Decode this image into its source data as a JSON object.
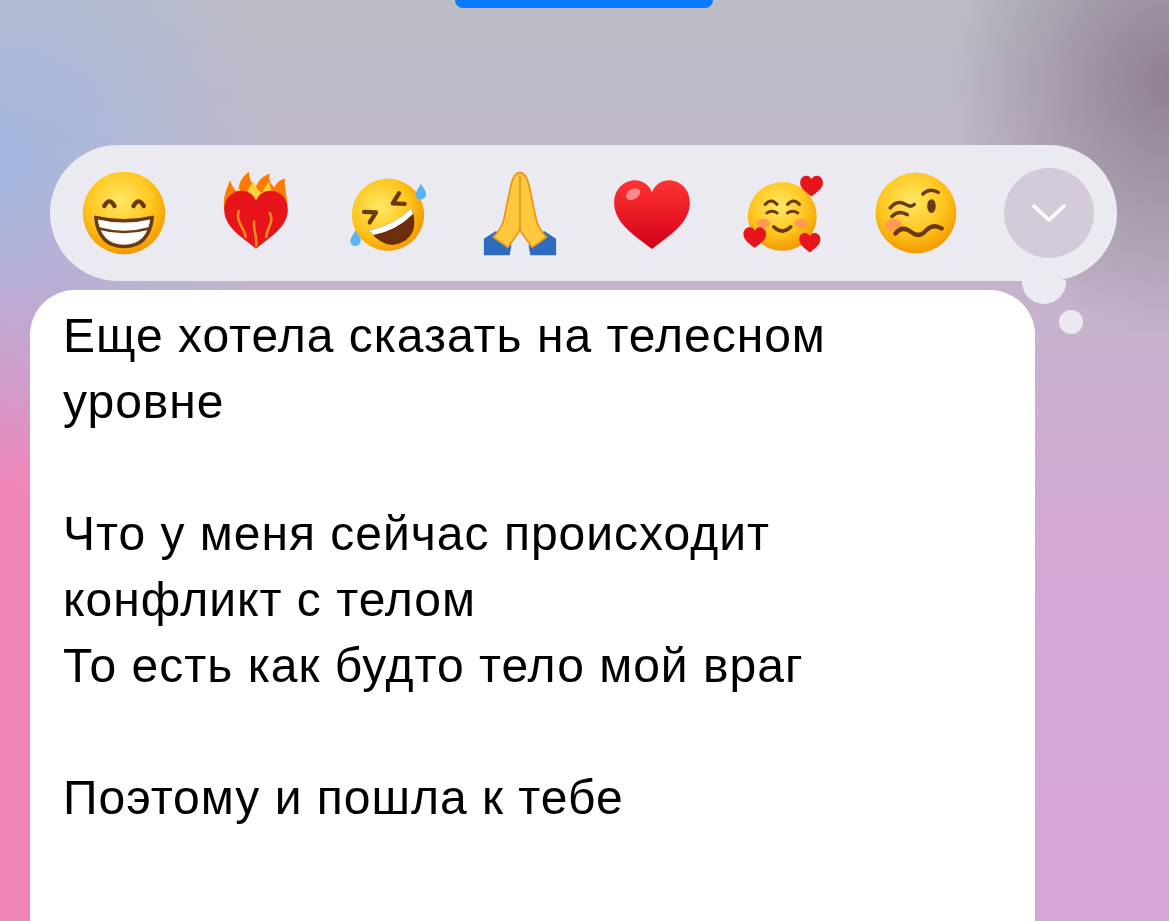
{
  "reaction_bar": {
    "reactions": [
      {
        "kind": "grin"
      },
      {
        "kind": "fireheart"
      },
      {
        "kind": "rofl"
      },
      {
        "kind": "pray"
      },
      {
        "kind": "heart"
      },
      {
        "kind": "adoring"
      },
      {
        "kind": "woozy"
      }
    ]
  },
  "message": {
    "text": "Еще хотела сказать на телесном уровне\n\nЧто у меня сейчас происходит конфликт с телом\nТо есть как будто тело мой враг\n\nПоэтому и пошла к тебе"
  }
}
